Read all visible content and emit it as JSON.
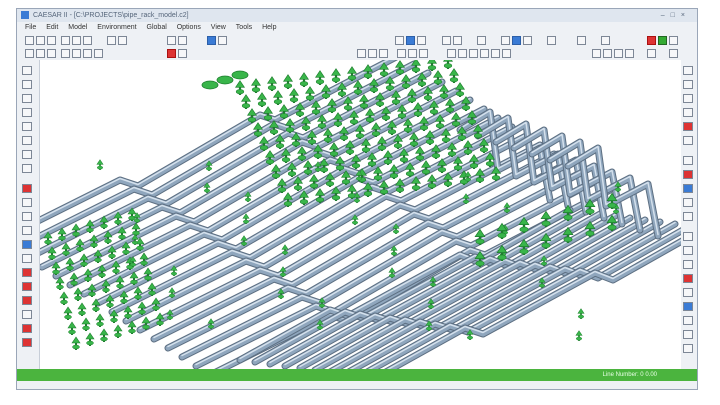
{
  "window": {
    "title": "CAESAR II - [C:\\PROJECTS\\pipe_rack_model.c2]"
  },
  "menu": [
    "File",
    "Edit",
    "Model",
    "Environment",
    "Global",
    "Options",
    "View",
    "Tools",
    "Help"
  ],
  "status": {
    "text": "Line Number: 0    0.00"
  },
  "colors": {
    "pipe": "#8fa6bd",
    "pipe_highlight": "#d4e0ec",
    "restraint": "#39b54a",
    "status_bar": "#4bb43e"
  },
  "icons": {
    "title_controls": [
      "minimize-icon",
      "maximize-icon",
      "close-icon"
    ],
    "toolbar": [
      "new-icon",
      "open-icon",
      "save-icon",
      "print-icon",
      "undo-icon",
      "redo-icon",
      "zoom-icon",
      "pan-icon",
      "rotate-icon",
      "render-icon",
      "wireframe-icon",
      "restraint-icon"
    ]
  }
}
